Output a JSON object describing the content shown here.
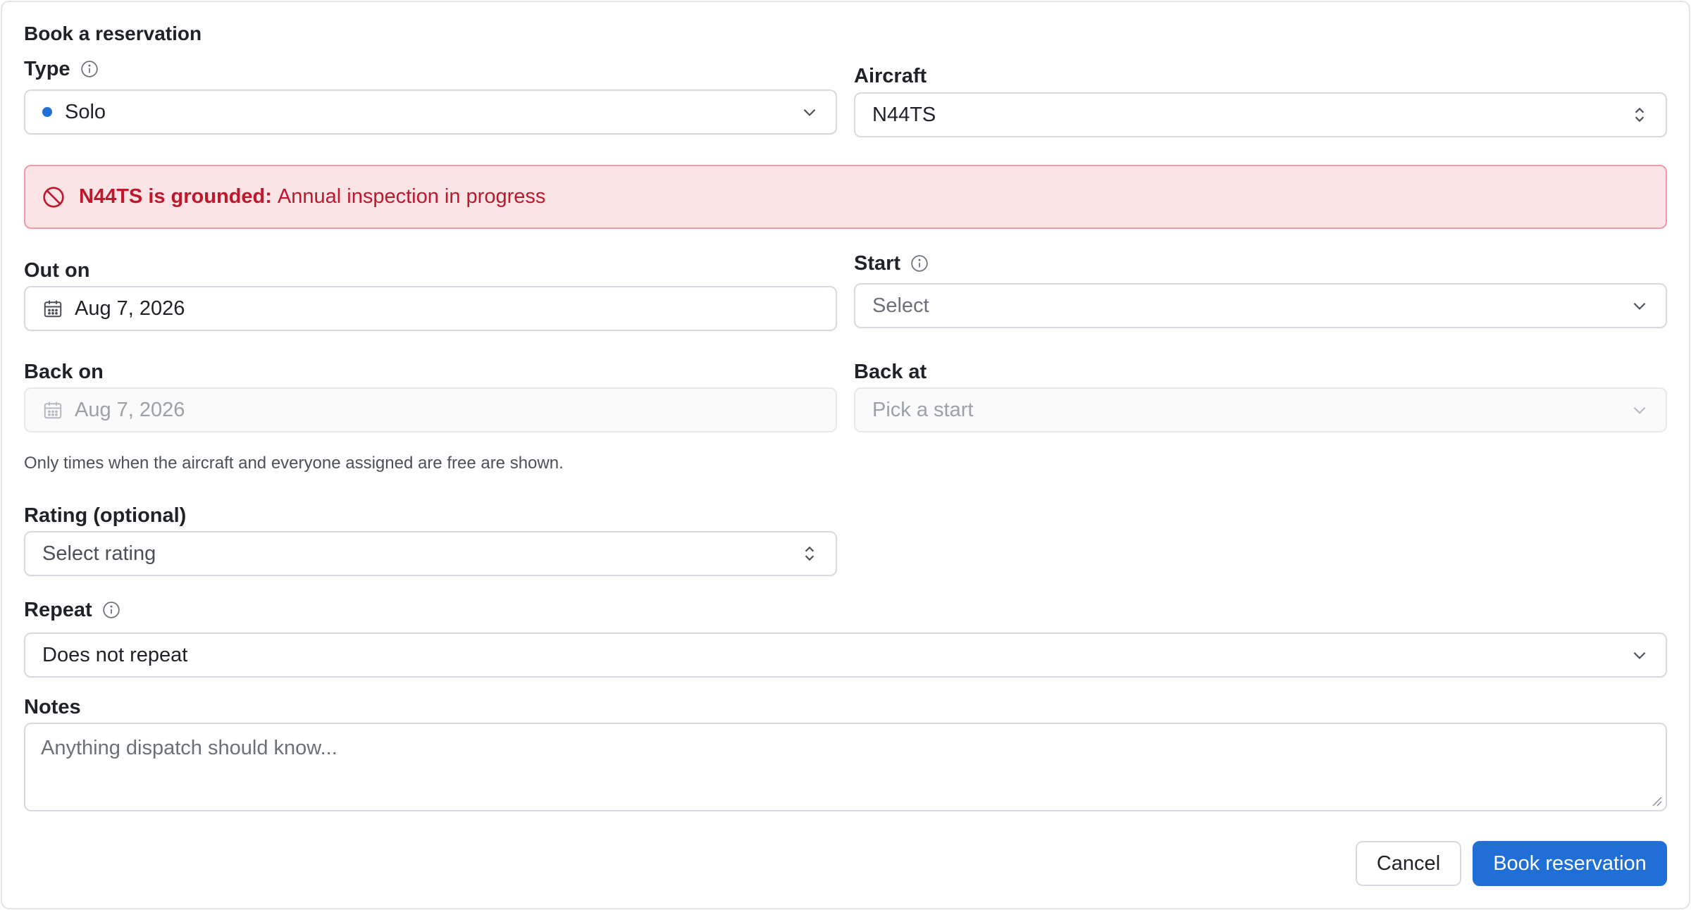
{
  "form": {
    "title": "Book a reservation",
    "type": {
      "label": "Type",
      "value": "Solo",
      "dot_color": "#1f6fd6"
    },
    "aircraft": {
      "label": "Aircraft",
      "value": "N44TS"
    },
    "alert": {
      "strong": "N44TS is grounded:",
      "text": "Annual inspection in progress"
    },
    "out_on": {
      "label": "Out on",
      "value": "Aug 7, 2026"
    },
    "start": {
      "label": "Start",
      "placeholder": "Select"
    },
    "back_on": {
      "label": "Back on",
      "value": "Aug 7, 2026"
    },
    "back_at": {
      "label": "Back at",
      "placeholder": "Pick a start"
    },
    "hint": "Only times when the aircraft and everyone assigned are free are shown.",
    "rating": {
      "label": "Rating (optional)",
      "placeholder": "Select rating"
    },
    "repeat": {
      "label": "Repeat",
      "value": "Does not repeat"
    },
    "notes": {
      "label": "Notes",
      "placeholder": "Anything dispatch should know..."
    },
    "buttons": {
      "cancel": "Cancel",
      "submit": "Book reservation"
    }
  },
  "colors": {
    "primary": "#1f6fd6",
    "danger": "#c0172c",
    "danger_bg": "#fbe4e6"
  }
}
